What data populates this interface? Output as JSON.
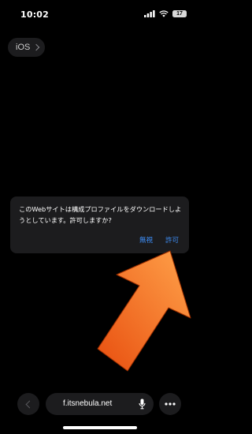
{
  "status_bar": {
    "time": "10:02",
    "battery_level": "17"
  },
  "nav": {
    "back_label": "iOS"
  },
  "dialog": {
    "message": "このWebサイトは構成プロファイルをダウンロードしようとしています。許可しますか?",
    "ignore_label": "無視",
    "allow_label": "許可",
    "accent_color": "#3e8ef7"
  },
  "arrow": {
    "color": "#f5701a",
    "points_to": "allow-button"
  },
  "bottom_bar": {
    "url": "f.itsnebula.net"
  },
  "icons": [
    "signal-icon",
    "wifi-icon",
    "battery-icon",
    "chevron-right-icon",
    "back-chevron-icon",
    "microphone-icon",
    "more-icon"
  ]
}
